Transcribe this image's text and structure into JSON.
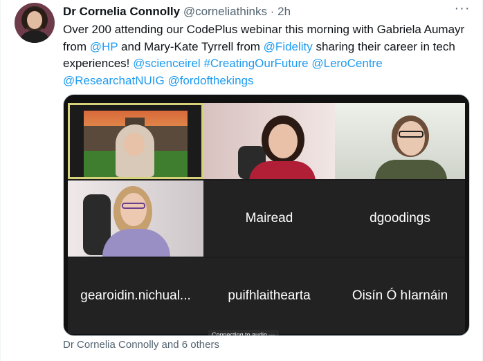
{
  "tweet": {
    "author_name": "Dr Cornelia Connolly",
    "author_handle": "@corneliathinks",
    "separator": "·",
    "time": "2h",
    "more_label": "···",
    "text": {
      "part1": "Over 200 attending our CodePlus webinar this morning with Gabriela Aumayr from ",
      "mention_hp": "@HP",
      "part2": " and Mary-Kate Tyrrell from ",
      "mention_fidelity": "@Fidelity",
      "part3": "  sharing their career in tech experiences! ",
      "mentions_tail": [
        "@scienceirel",
        "#CreatingOurFuture",
        "@LeroCentre",
        "@ResearchatNUIG",
        "@fordofthekings"
      ]
    },
    "tagged_people": "Dr Cornelia Connolly and 6 others"
  },
  "video_call": {
    "participants": [
      {
        "name": ""
      },
      {
        "name": ""
      },
      {
        "name": ""
      },
      {
        "name": ""
      },
      {
        "name": "Mairead"
      },
      {
        "name": "dgoodings"
      },
      {
        "name": "gearoidin.nichual..."
      },
      {
        "name": "puifhlaithearta"
      },
      {
        "name": "Oisín Ó hIarnáin"
      }
    ],
    "status_toast": "Connecting to audio ···",
    "active_speaker_color": "#d6d27a"
  },
  "colors": {
    "link": "#1d9bf0",
    "text_primary": "#0f1419",
    "text_secondary": "#536471"
  }
}
